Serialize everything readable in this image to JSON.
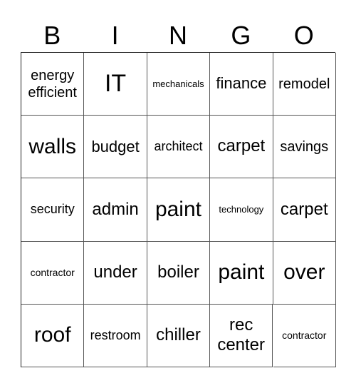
{
  "title_letters": [
    "B",
    "I",
    "N",
    "G",
    "O"
  ],
  "cells": [
    [
      "energy efficient",
      "IT",
      "mechanicals",
      "finance",
      "remodel"
    ],
    [
      "walls",
      "budget",
      "architect",
      "carpet",
      "savings"
    ],
    [
      "security",
      "admin",
      "paint",
      "technology",
      "carpet"
    ],
    [
      "contractor",
      "under",
      "boiler",
      "paint",
      "over"
    ],
    [
      "roof",
      "restroom",
      "chiller",
      "rec center",
      "contractor"
    ]
  ]
}
